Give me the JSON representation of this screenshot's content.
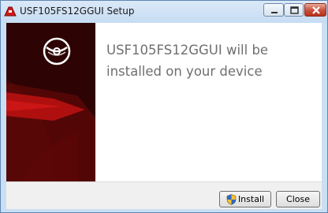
{
  "window": {
    "title": "USF105FS12GGUI Setup"
  },
  "banner": {
    "icon": "disc-icon",
    "colors": {
      "dark": "#3d0505",
      "accent": "#b00f0f"
    }
  },
  "content": {
    "headline": "USF105FS12GGUI will be installed on your device"
  },
  "buttons": {
    "install_label": "Install",
    "close_label": "Close",
    "install_icon": "uac-shield-icon"
  },
  "caption_buttons": [
    "minimize-icon",
    "maximize-icon",
    "close-icon"
  ]
}
